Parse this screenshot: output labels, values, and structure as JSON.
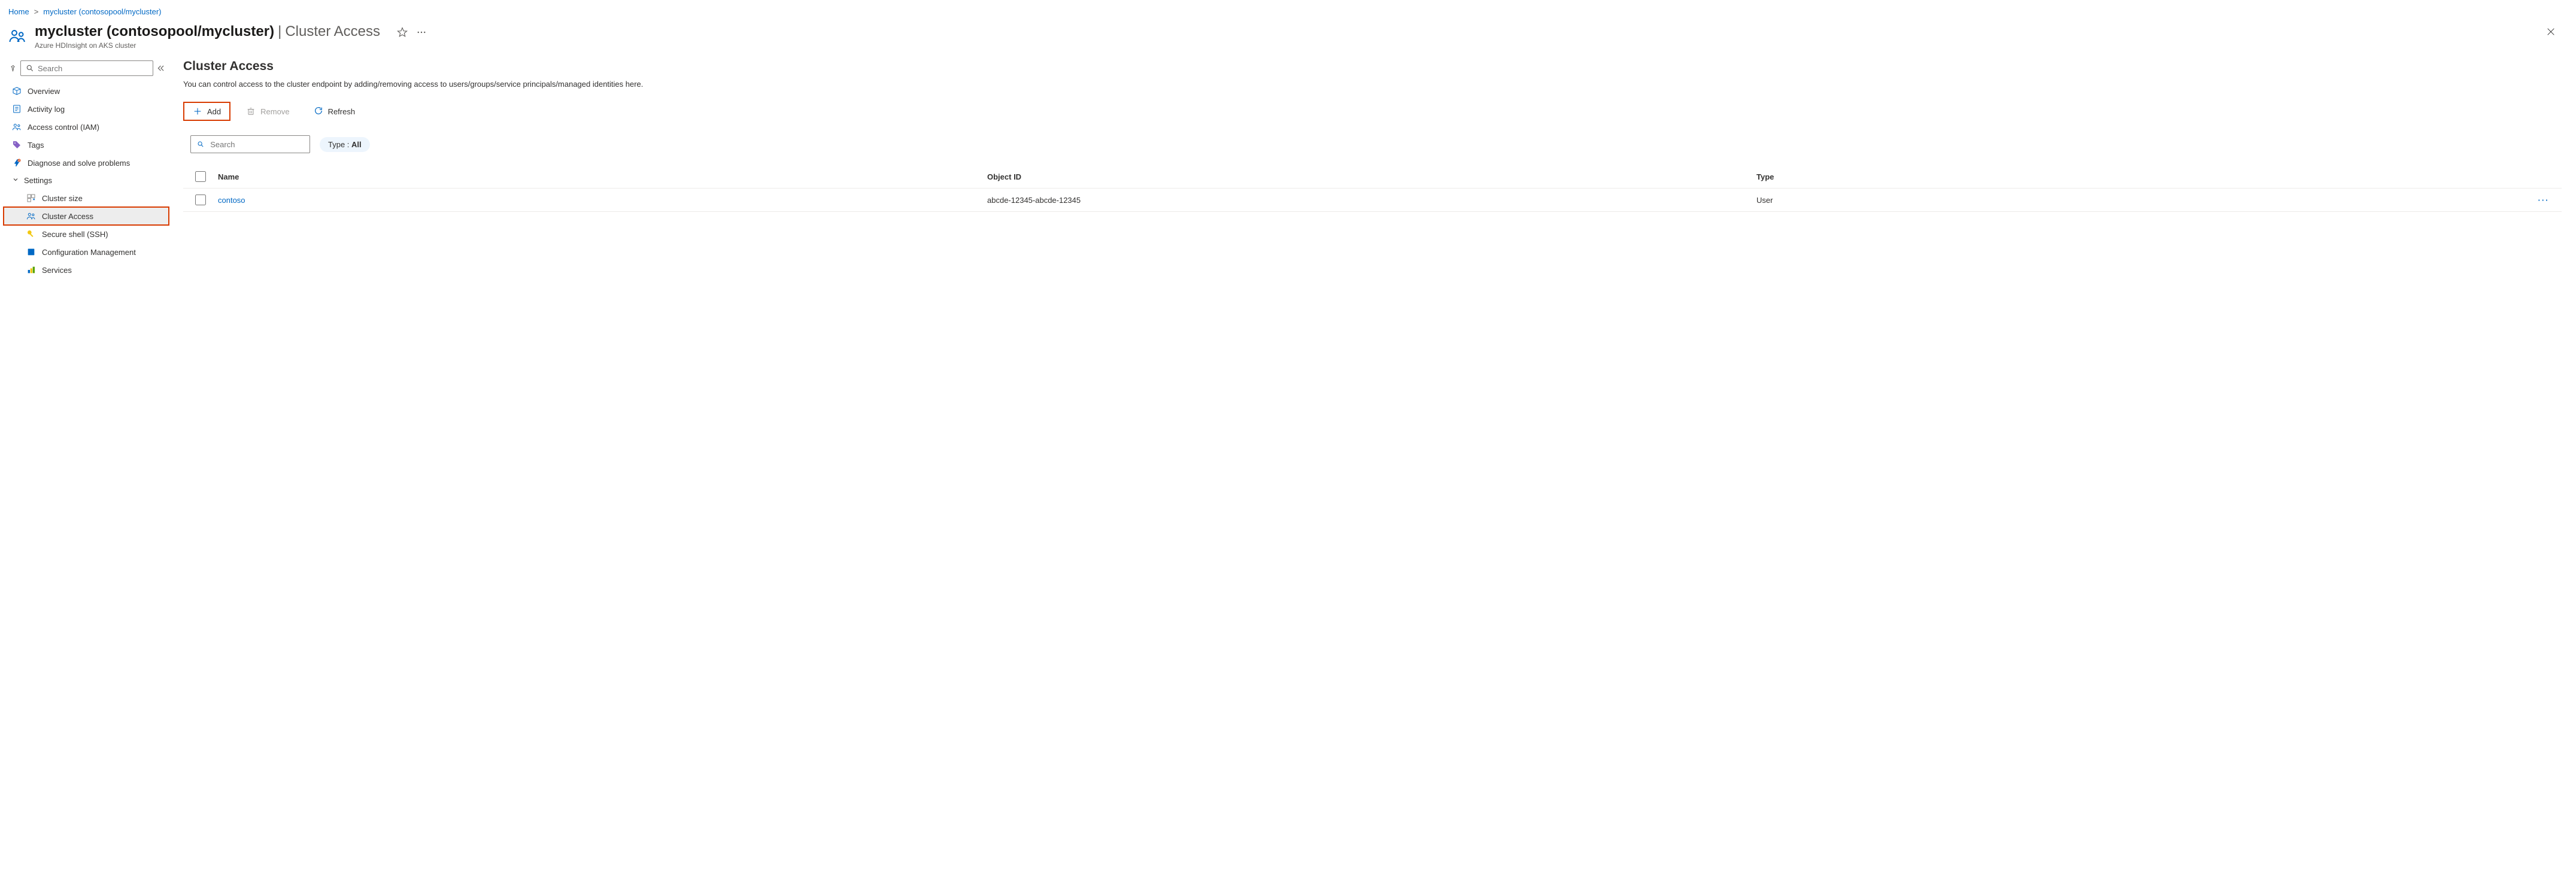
{
  "breadcrumb": {
    "home": "Home",
    "current": "mycluster (contosopool/mycluster)"
  },
  "header": {
    "title": "mycluster (contosopool/mycluster)",
    "tab_separator": "|",
    "tab_name": "Cluster Access",
    "subtitle": "Azure HDInsight on AKS cluster"
  },
  "sidebar": {
    "search_placeholder": "Search",
    "items": {
      "overview": "Overview",
      "activity_log": "Activity log",
      "access_control": "Access control (IAM)",
      "tags": "Tags",
      "diagnose": "Diagnose and solve problems",
      "settings_header": "Settings",
      "cluster_size": "Cluster size",
      "cluster_access": "Cluster Access",
      "secure_shell": "Secure shell (SSH)",
      "config_mgmt": "Configuration Management",
      "services": "Services"
    }
  },
  "main": {
    "heading": "Cluster Access",
    "description": "You can control access to the cluster endpoint by adding/removing access to users/groups/service principals/managed identities here.",
    "toolbar": {
      "add": "Add",
      "remove": "Remove",
      "refresh": "Refresh"
    },
    "filter": {
      "search_placeholder": "Search",
      "type_label": "Type : ",
      "type_value": "All"
    },
    "table": {
      "columns": {
        "name": "Name",
        "object_id": "Object ID",
        "type": "Type"
      },
      "rows": [
        {
          "name": "contoso",
          "object_id": "abcde-12345-abcde-12345",
          "type": "User"
        }
      ]
    }
  }
}
